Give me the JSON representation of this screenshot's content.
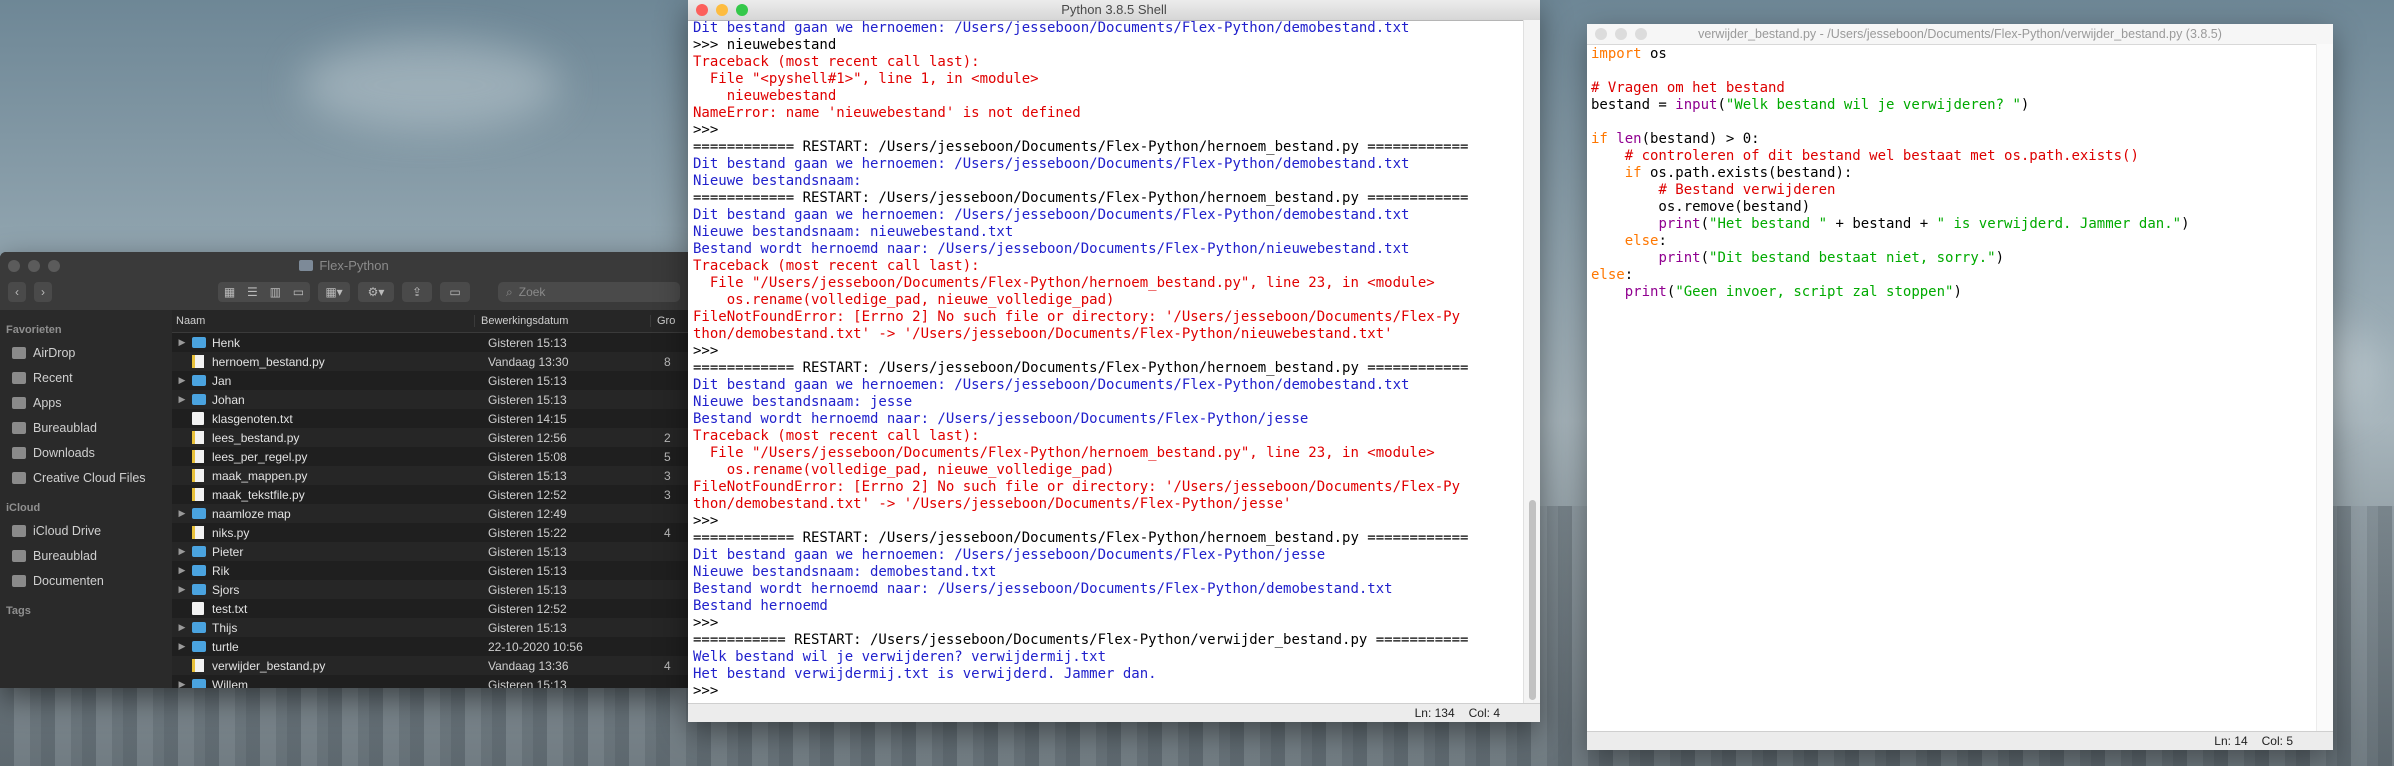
{
  "finder": {
    "title": "Flex-Python",
    "search_placeholder": "Zoek",
    "sidebar": {
      "favorites_header": "Favorieten",
      "favorites": [
        "AirDrop",
        "Recent",
        "Apps",
        "Bureaublad",
        "Downloads",
        "Creative Cloud Files"
      ],
      "icloud_header": "iCloud",
      "icloud": [
        "iCloud Drive",
        "Bureaublad",
        "Documenten"
      ],
      "tags_header": "Tags"
    },
    "columns": {
      "name": "Naam",
      "date": "Bewerkingsdatum",
      "size": "Gro"
    },
    "rows": [
      {
        "name": "Henk",
        "date": "Gisteren 15:13",
        "size": "",
        "type": "folder"
      },
      {
        "name": "hernoem_bestand.py",
        "date": "Vandaag 13:30",
        "size": "8",
        "type": "py"
      },
      {
        "name": "Jan",
        "date": "Gisteren 15:13",
        "size": "",
        "type": "folder"
      },
      {
        "name": "Johan",
        "date": "Gisteren 15:13",
        "size": "",
        "type": "folder"
      },
      {
        "name": "klasgenoten.txt",
        "date": "Gisteren 14:15",
        "size": "",
        "type": "file"
      },
      {
        "name": "lees_bestand.py",
        "date": "Gisteren 12:56",
        "size": "2",
        "type": "py"
      },
      {
        "name": "lees_per_regel.py",
        "date": "Gisteren 15:08",
        "size": "5",
        "type": "py"
      },
      {
        "name": "maak_mappen.py",
        "date": "Gisteren 15:13",
        "size": "3",
        "type": "py"
      },
      {
        "name": "maak_tekstfile.py",
        "date": "Gisteren 12:52",
        "size": "3",
        "type": "py"
      },
      {
        "name": "naamloze map",
        "date": "Gisteren 12:49",
        "size": "",
        "type": "folder"
      },
      {
        "name": "niks.py",
        "date": "Gisteren 15:22",
        "size": "4",
        "type": "py"
      },
      {
        "name": "Pieter",
        "date": "Gisteren 15:13",
        "size": "",
        "type": "folder"
      },
      {
        "name": "Rik",
        "date": "Gisteren 15:13",
        "size": "",
        "type": "folder"
      },
      {
        "name": "Sjors",
        "date": "Gisteren 15:13",
        "size": "",
        "type": "folder"
      },
      {
        "name": "test.txt",
        "date": "Gisteren 12:52",
        "size": "",
        "type": "file"
      },
      {
        "name": "Thijs",
        "date": "Gisteren 15:13",
        "size": "",
        "type": "folder"
      },
      {
        "name": "turtle",
        "date": "22-10-2020 10:56",
        "size": "",
        "type": "folder"
      },
      {
        "name": "verwijder_bestand.py",
        "date": "Vandaag 13:36",
        "size": "4",
        "type": "py"
      },
      {
        "name": "Willem",
        "date": "Gisteren 15:13",
        "size": "",
        "type": "folder"
      }
    ]
  },
  "shell": {
    "title": "Python 3.8.5 Shell",
    "lines": [
      {
        "t": "Dit bestand gaan we hernoemen: /Users/jesseboon/Documents/Flex-Python/demobestand.txt",
        "c": "blue"
      },
      {
        "t": ">>> nieuwebestand",
        "c": "black"
      },
      {
        "t": "Traceback (most recent call last):",
        "c": "red"
      },
      {
        "t": "  File \"<pyshell#1>\", line 1, in <module>",
        "c": "red"
      },
      {
        "t": "    nieuwebestand",
        "c": "red"
      },
      {
        "t": "NameError: name 'nieuwebestand' is not defined",
        "c": "red"
      },
      {
        "t": ">>>",
        "c": "black"
      },
      {
        "t": "============ RESTART: /Users/jesseboon/Documents/Flex-Python/hernoem_bestand.py ============",
        "c": "black"
      },
      {
        "t": "Dit bestand gaan we hernoemen: /Users/jesseboon/Documents/Flex-Python/demobestand.txt",
        "c": "blue"
      },
      {
        "t": "Nieuwe bestandsnaam:",
        "c": "blue"
      },
      {
        "t": "============ RESTART: /Users/jesseboon/Documents/Flex-Python/hernoem_bestand.py ============",
        "c": "black"
      },
      {
        "t": "Dit bestand gaan we hernoemen: /Users/jesseboon/Documents/Flex-Python/demobestand.txt",
        "c": "blue"
      },
      {
        "t": "Nieuwe bestandsnaam: nieuwebestand.txt",
        "c": "blue"
      },
      {
        "t": "Bestand wordt hernoemd naar: /Users/jesseboon/Documents/Flex-Python/nieuwebestand.txt",
        "c": "blue"
      },
      {
        "t": "Traceback (most recent call last):",
        "c": "red"
      },
      {
        "t": "  File \"/Users/jesseboon/Documents/Flex-Python/hernoem_bestand.py\", line 23, in <module>",
        "c": "red"
      },
      {
        "t": "    os.rename(volledige_pad, nieuwe_volledige_pad)",
        "c": "red"
      },
      {
        "t": "FileNotFoundError: [Errno 2] No such file or directory: '/Users/jesseboon/Documents/Flex-Py",
        "c": "red"
      },
      {
        "t": "thon/demobestand.txt' -> '/Users/jesseboon/Documents/Flex-Python/nieuwebestand.txt'",
        "c": "red"
      },
      {
        "t": ">>>",
        "c": "black"
      },
      {
        "t": "============ RESTART: /Users/jesseboon/Documents/Flex-Python/hernoem_bestand.py ============",
        "c": "black"
      },
      {
        "t": "Dit bestand gaan we hernoemen: /Users/jesseboon/Documents/Flex-Python/demobestand.txt",
        "c": "blue"
      },
      {
        "t": "Nieuwe bestandsnaam: jesse",
        "c": "blue"
      },
      {
        "t": "Bestand wordt hernoemd naar: /Users/jesseboon/Documents/Flex-Python/jesse",
        "c": "blue"
      },
      {
        "t": "Traceback (most recent call last):",
        "c": "red"
      },
      {
        "t": "  File \"/Users/jesseboon/Documents/Flex-Python/hernoem_bestand.py\", line 23, in <module>",
        "c": "red"
      },
      {
        "t": "    os.rename(volledige_pad, nieuwe_volledige_pad)",
        "c": "red"
      },
      {
        "t": "FileNotFoundError: [Errno 2] No such file or directory: '/Users/jesseboon/Documents/Flex-Py",
        "c": "red"
      },
      {
        "t": "thon/demobestand.txt' -> '/Users/jesseboon/Documents/Flex-Python/jesse'",
        "c": "red"
      },
      {
        "t": ">>>",
        "c": "black"
      },
      {
        "t": "============ RESTART: /Users/jesseboon/Documents/Flex-Python/hernoem_bestand.py ============",
        "c": "black"
      },
      {
        "t": "Dit bestand gaan we hernoemen: /Users/jesseboon/Documents/Flex-Python/jesse",
        "c": "blue"
      },
      {
        "t": "Nieuwe bestandsnaam: demobestand.txt",
        "c": "blue"
      },
      {
        "t": "Bestand wordt hernoemd naar: /Users/jesseboon/Documents/Flex-Python/demobestand.txt",
        "c": "blue"
      },
      {
        "t": "Bestand hernoemd",
        "c": "blue"
      },
      {
        "t": ">>>",
        "c": "black"
      },
      {
        "t": "=========== RESTART: /Users/jesseboon/Documents/Flex-Python/verwijder_bestand.py ===========",
        "c": "black"
      },
      {
        "t": "Welk bestand wil je verwijderen? verwijdermij.txt",
        "c": "blue"
      },
      {
        "t": "Het bestand verwijdermij.txt is verwijderd. Jammer dan.",
        "c": "blue"
      },
      {
        "t": ">>>",
        "c": "black"
      }
    ],
    "status_line": "Ln: 134",
    "status_col": "Col: 4"
  },
  "editor": {
    "title": "verwijder_bestand.py - /Users/jesseboon/Documents/Flex-Python/verwijder_bestand.py (3.8.5)",
    "code": [
      [
        [
          "kw",
          "import"
        ],
        [
          "n",
          " os"
        ]
      ],
      [
        [
          "n",
          ""
        ]
      ],
      [
        [
          "cm",
          "# Vragen om het bestand"
        ]
      ],
      [
        [
          "n",
          "bestand = "
        ],
        [
          "bi",
          "input"
        ],
        [
          "n",
          "("
        ],
        [
          "str",
          "\"Welk bestand wil je verwijderen? \""
        ],
        [
          "n",
          ")"
        ]
      ],
      [
        [
          "n",
          ""
        ]
      ],
      [
        [
          "kw",
          "if"
        ],
        [
          "n",
          " "
        ],
        [
          "bi",
          "len"
        ],
        [
          "n",
          "(bestand) > 0:"
        ]
      ],
      [
        [
          "n",
          "    "
        ],
        [
          "cm",
          "# controleren of dit bestand wel bestaat met os.path.exists()"
        ]
      ],
      [
        [
          "n",
          "    "
        ],
        [
          "kw",
          "if"
        ],
        [
          "n",
          " os.path.exists(bestand):"
        ]
      ],
      [
        [
          "n",
          "        "
        ],
        [
          "cm",
          "# Bestand verwijderen"
        ]
      ],
      [
        [
          "n",
          "        os.remove(bestand)"
        ]
      ],
      [
        [
          "n",
          "        "
        ],
        [
          "bi",
          "print"
        ],
        [
          "n",
          "("
        ],
        [
          "str",
          "\"Het bestand \""
        ],
        [
          "n",
          " + bestand + "
        ],
        [
          "str",
          "\" is verwijderd. Jammer dan.\""
        ],
        [
          "n",
          ")"
        ]
      ],
      [
        [
          "n",
          "    "
        ],
        [
          "kw",
          "else"
        ],
        [
          "n",
          ":"
        ]
      ],
      [
        [
          "n",
          "        "
        ],
        [
          "bi",
          "print"
        ],
        [
          "n",
          "("
        ],
        [
          "str",
          "\"Dit bestand bestaat niet, sorry.\""
        ],
        [
          "n",
          ")"
        ]
      ],
      [
        [
          "kw",
          "else"
        ],
        [
          "n",
          ":"
        ]
      ],
      [
        [
          "n",
          "    "
        ],
        [
          "bi",
          "print"
        ],
        [
          "n",
          "("
        ],
        [
          "str",
          "\"Geen invoer, script zal stoppen\""
        ],
        [
          "n",
          ")"
        ]
      ]
    ],
    "status_line": "Ln: 14",
    "status_col": "Col: 5"
  }
}
